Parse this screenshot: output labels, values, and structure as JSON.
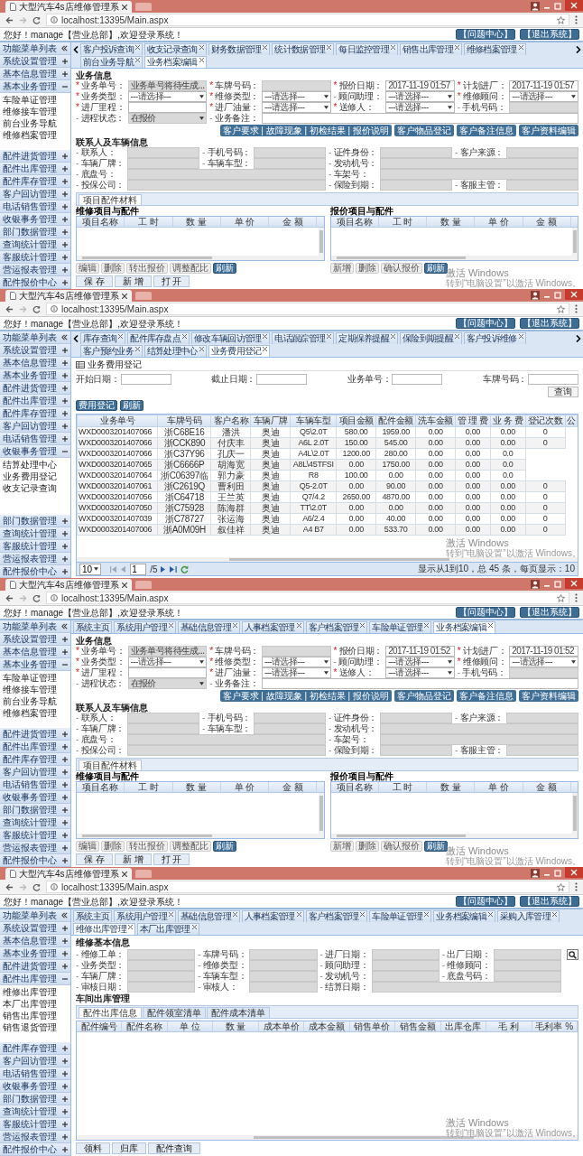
{
  "screens": [
    {
      "browser": {
        "tab_title": "大型汽车4s店维修管理系",
        "url": "localhost:13395/Main.aspx"
      },
      "greeting": "您好！manage【营业总部】,欢迎登录系统！",
      "header_buttons": [
        "【问题中心】",
        "【退出系统】"
      ],
      "sidebar": {
        "title": "功能菜单列表",
        "groups": [
          {
            "label": "系统设置管理",
            "expanded": false
          },
          {
            "label": "基本信息管理",
            "expanded": false
          },
          {
            "label": "基本业务管理",
            "expanded": true,
            "children": [
              "车险单证管理",
              "维修接车管理",
              "前台业务导航",
              "维修档案管理"
            ]
          },
          {
            "label": "配件进货管理",
            "expanded": false
          },
          {
            "label": "配件出库管理",
            "expanded": false
          },
          {
            "label": "配件库存管理",
            "expanded": false
          },
          {
            "label": "客户回访管理",
            "expanded": false
          },
          {
            "label": "电话销售管理",
            "expanded": false
          },
          {
            "label": "收银事务管理",
            "expanded": false
          },
          {
            "label": "部门数据管理",
            "expanded": false
          },
          {
            "label": "查询统计管理",
            "expanded": false
          },
          {
            "label": "客服统计管理",
            "expanded": false
          },
          {
            "label": "营运报表管理",
            "expanded": false
          },
          {
            "label": "配件报价中心",
            "expanded": false
          }
        ]
      },
      "scroll_arrows": true,
      "tabs": [
        {
          "label": "客户投诉查询",
          "selected": false,
          "closable": true
        },
        {
          "label": "收支记录查询",
          "selected": false,
          "closable": true
        },
        {
          "label": "财务数据管理",
          "selected": false,
          "closable": true
        },
        {
          "label": "统计数据管理",
          "selected": false,
          "closable": true
        },
        {
          "label": "每日监控管理",
          "selected": false,
          "closable": true
        },
        {
          "label": "销售出库管理",
          "selected": false,
          "closable": true
        },
        {
          "label": "维修档案管理",
          "selected": false,
          "closable": true
        },
        {
          "label": "前台业务导航",
          "selected": false,
          "closable": true
        },
        {
          "label": "业务档案编辑",
          "selected": true,
          "closable": true
        }
      ],
      "content": {
        "kind": "business_form",
        "sections": [
          {
            "title": "业务信息",
            "rows": [
              [
                {
                  "mark": "*",
                  "required": true,
                  "label": "业务单号：",
                  "kind": "text",
                  "value": "业务单号将待生成...",
                  "disabled": true
                },
                {
                  "mark": "*",
                  "required": true,
                  "label": "车牌号码：",
                  "kind": "text",
                  "disabled": true
                },
                {
                  "mark": "*",
                  "required": true,
                  "label": "报价日期：",
                  "kind": "text",
                  "value": "2017-11-19 01:57",
                  "disabled": false
                },
                {
                  "mark": "*",
                  "required": true,
                  "label": "计划进厂：",
                  "kind": "text",
                  "value": "2017-11-19 01:57",
                  "disabled": false
                }
              ],
              [
                {
                  "mark": "*",
                  "required": true,
                  "label": "业务类型：",
                  "kind": "select",
                  "value": "---请选择---",
                  "disabled": false
                },
                {
                  "mark": "*",
                  "required": true,
                  "label": "维修类型：",
                  "kind": "select",
                  "value": "---请选择---",
                  "disabled": false
                },
                {
                  "mark": "-",
                  "required": false,
                  "label": "顾问助理：",
                  "kind": "select",
                  "value": "---请选择---",
                  "disabled": false
                },
                {
                  "mark": "*",
                  "required": true,
                  "label": "维修顾问：",
                  "kind": "select",
                  "value": "---请选择---",
                  "disabled": false
                }
              ],
              [
                {
                  "mark": "*",
                  "required": true,
                  "label": "进厂里程：",
                  "kind": "text",
                  "disabled": false
                },
                {
                  "mark": "*",
                  "required": true,
                  "label": "进厂油量：",
                  "kind": "select",
                  "value": "---请选择---",
                  "disabled": false
                },
                {
                  "mark": "*",
                  "required": true,
                  "label": "送修人：",
                  "kind": "select",
                  "value": "---请选择---",
                  "disabled": false
                },
                {
                  "mark": "-",
                  "required": false,
                  "label": "手机号码：",
                  "kind": "text",
                  "disabled": true
                }
              ],
              [
                {
                  "mark": "-",
                  "required": false,
                  "label": "进程状态：",
                  "kind": "select",
                  "value": "在报价",
                  "disabled": true
                },
                {
                  "mark": "-",
                  "required": false,
                  "label": "业务备注：",
                  "kind": "text",
                  "disabled": false
                },
                "",
                ""
              ]
            ],
            "actions": [
              "客户要求 | 故障现象 | 初检结果 | 报价说明",
              "客户物品登记",
              "客户备注信息",
              "客户资料编辑"
            ]
          },
          {
            "title": "联系人及车辆信息",
            "rows": [
              [
                {
                  "mark": "-",
                  "required": false,
                  "label": "联系人：",
                  "kind": "text",
                  "disabled": true
                },
                {
                  "mark": "-",
                  "required": false,
                  "label": "手机号码：",
                  "kind": "text",
                  "disabled": true
                },
                {
                  "mark": "-",
                  "required": false,
                  "label": "证件身份：",
                  "kind": "text",
                  "disabled": true
                },
                {
                  "mark": "-",
                  "required": false,
                  "label": "客户来源：",
                  "kind": "text",
                  "disabled": true
                }
              ],
              [
                {
                  "mark": "-",
                  "required": false,
                  "label": "车辆厂牌：",
                  "kind": "text",
                  "disabled": true
                },
                {
                  "mark": "-",
                  "required": false,
                  "label": "车辆车型：",
                  "kind": "text",
                  "disabled": true
                },
                {
                  "mark": "-",
                  "required": false,
                  "label": "发动机号：",
                  "kind": "text",
                  "disabled": true
                },
                ""
              ],
              [
                {
                  "mark": "-",
                  "required": false,
                  "label": "底盘号：",
                  "kind": "text",
                  "disabled": true
                },
                "",
                {
                  "mark": "-",
                  "required": false,
                  "label": "车架号：",
                  "kind": "text",
                  "disabled": true
                },
                ""
              ],
              [
                {
                  "mark": "-",
                  "required": false,
                  "label": "投保公司：",
                  "kind": "text",
                  "disabled": true
                },
                "",
                {
                  "mark": "-",
                  "required": false,
                  "label": "保险到期：",
                  "kind": "text",
                  "disabled": true
                },
                {
                  "mark": "-",
                  "required": false,
                  "label": "客服主管：",
                  "kind": "text",
                  "disabled": true
                }
              ]
            ]
          }
        ],
        "subtab": "项目配件材料",
        "grids": [
          {
            "title": "维修项目与配件",
            "columns": [
              "项目名称",
              "工 时",
              "数 量",
              "单 价",
              "金 额"
            ],
            "buttons": [
              {
                "label": "编辑",
                "kind": "plain"
              },
              {
                "label": "删除",
                "kind": "plain"
              },
              {
                "label": "转出报价",
                "kind": "plain"
              },
              {
                "label": "调整配比",
                "kind": "plain"
              },
              {
                "label": "刷新",
                "kind": "primary"
              }
            ]
          },
          {
            "title": "报价项目与配件",
            "columns": [
              "项目名称",
              "工 时",
              "数 量",
              "单 价",
              "金 额"
            ],
            "buttons": [
              {
                "label": "新增",
                "kind": "plain"
              },
              {
                "label": "删除",
                "kind": "plain"
              },
              {
                "label": "确认报价",
                "kind": "plain"
              },
              {
                "label": "刷新",
                "kind": "primary"
              }
            ]
          }
        ],
        "footer_buttons": [
          "保 存",
          "新 增",
          "打 开"
        ]
      },
      "os_notice": {
        "title": "激活 Windows",
        "text": "转到“电脑设置”以激活 Windows。"
      }
    },
    {
      "browser": {
        "tab_title": "大型汽车4s店维修管理系",
        "url": "localhost:13395/Main.aspx"
      },
      "greeting": "您好！manage【营业总部】,欢迎登录系统！",
      "header_buttons": [
        "【问题中心】",
        "【退出系统】"
      ],
      "sidebar": {
        "title": "功能菜单列表",
        "groups": [
          {
            "label": "系统设置管理",
            "expanded": false
          },
          {
            "label": "基本信息管理",
            "expanded": false
          },
          {
            "label": "基本业务管理",
            "expanded": false
          },
          {
            "label": "配件进货管理",
            "expanded": false
          },
          {
            "label": "配件出库管理",
            "expanded": false
          },
          {
            "label": "配件库存管理",
            "expanded": false
          },
          {
            "label": "客户回访管理",
            "expanded": false
          },
          {
            "label": "电话销售管理",
            "expanded": false
          },
          {
            "label": "收银事务管理",
            "expanded": true,
            "children": [
              "结算处理中心",
              "业务费用登记",
              "收支记录查询"
            ]
          },
          {
            "label": "部门数据管理",
            "expanded": false
          },
          {
            "label": "查询统计管理",
            "expanded": false
          },
          {
            "label": "客服统计管理",
            "expanded": false
          },
          {
            "label": "营运报表管理",
            "expanded": false
          },
          {
            "label": "配件报价中心",
            "expanded": false
          }
        ]
      },
      "scroll_arrows": true,
      "tabs": [
        {
          "label": "库存查询",
          "selected": false,
          "closable": true
        },
        {
          "label": "配件库存盘点",
          "selected": false,
          "closable": true
        },
        {
          "label": "修改车辆回访管理",
          "selected": false,
          "closable": true
        },
        {
          "label": "电话跟踪管理",
          "selected": false,
          "closable": true
        },
        {
          "label": "定期保养提醒",
          "selected": false,
          "closable": true
        },
        {
          "label": "保险到期提醒",
          "selected": false,
          "closable": true
        },
        {
          "label": "客户投诉维修",
          "selected": false,
          "closable": true
        },
        {
          "label": "客户预约业务",
          "selected": false,
          "closable": true
        },
        {
          "label": "结算处理中心",
          "selected": false,
          "closable": true
        },
        {
          "label": "业务费用登记",
          "selected": true,
          "closable": true
        }
      ],
      "content": {
        "kind": "fee_list",
        "title": "业务费用登记",
        "filters": [
          "开始日期：",
          "截止日期：",
          "业务单号：",
          "车牌号码："
        ],
        "search_button": "查询",
        "buttons": [
          {
            "label": "费用登记",
            "kind": "primary"
          },
          {
            "label": "刷新",
            "kind": "primary"
          }
        ],
        "columns": [
          "业务单号",
          "车牌号码",
          "客户名称",
          "车辆厂牌",
          "车辆车型",
          "项目金额",
          "配件金额",
          "洗车金额",
          "管 理 费",
          "业 务 费",
          "登记次数",
          "公"
        ],
        "rows": [
          [
            "WXD0003201407066",
            "浙C68E16",
            "潘洪",
            "奥迪",
            "Q5\\2.0T",
            "580.00",
            "1959.00",
            "0.00",
            "0.00",
            "0.00",
            "0"
          ],
          [
            "WXD0003201407066",
            "浙CCK890",
            "付庆丰",
            "奥迪",
            "A6L 2.0T",
            "150.00",
            "545.00",
            "0.00",
            "0.00",
            "0.00",
            "0"
          ],
          [
            "WXD0003201407066",
            "浙C37Y96",
            "孔庆一",
            "奥迪",
            "A4L\\2.0T",
            "1200.00",
            "280.00",
            "0.00",
            "0.00",
            "0.0"
          ],
          [
            "WXD0003201407065",
            "浙C6666P",
            "胡海宽",
            "奥迪",
            "A8L\\45TFSI",
            "0.00",
            "1750.00",
            "0.00",
            "0.00",
            "0.0"
          ],
          [
            "WXD0003201407064",
            "浙C06397临",
            "郭力豪",
            "奥迪",
            "R8",
            "100.00",
            "0.00",
            "0.00",
            "0.00",
            "0.0"
          ],
          [
            "WXD0003201407061",
            "浙C2619Q",
            "曹利田",
            "奥迪",
            "Q5-2.0T",
            "0.00",
            "90.00",
            "0.00",
            "0.00",
            "0.00",
            "0"
          ],
          [
            "WXD0003201407056",
            "浙C64718",
            "王兰英",
            "奥迪",
            "Q7/4.2",
            "2650.00",
            "4870.00",
            "0.00",
            "0.00",
            "0.00",
            "0"
          ],
          [
            "WXD0003201407050",
            "浙C75928",
            "陈海群",
            "奥迪",
            "TT\\2.0T",
            "0.00",
            "0.00",
            "0.00",
            "0.00",
            "0.00",
            "0"
          ],
          [
            "WXD0003201407039",
            "浙C78727",
            "张运海",
            "奥迪",
            "A6/2.4",
            "0.00",
            "40.00",
            "0.00",
            "0.00",
            "0.00",
            "0"
          ],
          [
            "WXD0003201407006",
            "浙A0M09H",
            "叙佳祥",
            "奥迪",
            "A4 B7",
            "0.00",
            "533.70",
            "0.00",
            "0.00",
            "0.00",
            "0"
          ]
        ],
        "pager": {
          "page_size": "10",
          "page": "1",
          "pages": "/5",
          "summary": "显示从1到10，总 45 条，每页显示：10"
        }
      },
      "os_notice": {
        "title": "激活 Windows",
        "text": "转到“电脑设置”以激活 Windows。"
      }
    },
    {
      "browser": {
        "tab_title": "大型汽车4s店维修管理系",
        "url": "localhost:13395/Main.aspx"
      },
      "greeting": "您好！manage【营业总部】,欢迎登录系统！",
      "header_buttons": [
        "【问题中心】",
        "【退出系统】"
      ],
      "sidebar": {
        "title": "功能菜单列表",
        "groups": [
          {
            "label": "系统设置管理",
            "expanded": false
          },
          {
            "label": "基本信息管理",
            "expanded": false
          },
          {
            "label": "基本业务管理",
            "expanded": true,
            "children": [
              "车险单证管理",
              "维修接车管理",
              "前台业务导航",
              "维修档案管理"
            ]
          },
          {
            "label": "配件进货管理",
            "expanded": false
          },
          {
            "label": "配件出库管理",
            "expanded": false
          },
          {
            "label": "配件库存管理",
            "expanded": false
          },
          {
            "label": "客户回访管理",
            "expanded": false
          },
          {
            "label": "电话销售管理",
            "expanded": false
          },
          {
            "label": "收银事务管理",
            "expanded": false
          },
          {
            "label": "部门数据管理",
            "expanded": false
          },
          {
            "label": "查询统计管理",
            "expanded": false
          },
          {
            "label": "客服统计管理",
            "expanded": false
          },
          {
            "label": "营运报表管理",
            "expanded": false
          },
          {
            "label": "配件报价中心",
            "expanded": false
          }
        ]
      },
      "scroll_arrows": false,
      "tabs": [
        {
          "label": "系统主页",
          "selected": false,
          "closable": false
        },
        {
          "label": "系统用户管理",
          "selected": false,
          "closable": true
        },
        {
          "label": "基础信息管理",
          "selected": false,
          "closable": true
        },
        {
          "label": "人事档案管理",
          "selected": false,
          "closable": true
        },
        {
          "label": "客户档案管理",
          "selected": false,
          "closable": true
        },
        {
          "label": "车险单证管理",
          "selected": false,
          "closable": true
        },
        {
          "label": "业务档案编辑",
          "selected": true,
          "closable": true
        }
      ],
      "content": {
        "kind": "business_form",
        "sections": [
          {
            "title": "业务信息",
            "rows": [
              [
                {
                  "mark": "*",
                  "required": true,
                  "label": "业务单号：",
                  "kind": "text",
                  "value": "业务单号将待生成...",
                  "disabled": true
                },
                {
                  "mark": "*",
                  "required": true,
                  "label": "车牌号码：",
                  "kind": "text",
                  "disabled": true
                },
                {
                  "mark": "*",
                  "required": true,
                  "label": "报价日期：",
                  "kind": "text",
                  "value": "2017-11-19 01:52",
                  "disabled": false
                },
                {
                  "mark": "*",
                  "required": true,
                  "label": "计划进厂：",
                  "kind": "text",
                  "value": "2017-11-19 01:52",
                  "disabled": false
                }
              ],
              [
                {
                  "mark": "*",
                  "required": true,
                  "label": "业务类型：",
                  "kind": "select",
                  "value": "---请选择---",
                  "disabled": false
                },
                {
                  "mark": "*",
                  "required": true,
                  "label": "维修类型：",
                  "kind": "select",
                  "value": "---请选择---",
                  "disabled": false
                },
                {
                  "mark": "-",
                  "required": false,
                  "label": "顾问助理：",
                  "kind": "select",
                  "value": "---请选择---",
                  "disabled": false
                },
                {
                  "mark": "*",
                  "required": true,
                  "label": "维修顾问：",
                  "kind": "select",
                  "value": "---请选择---",
                  "disabled": false
                }
              ],
              [
                {
                  "mark": "*",
                  "required": true,
                  "label": "进厂里程：",
                  "kind": "text",
                  "disabled": false
                },
                {
                  "mark": "*",
                  "required": true,
                  "label": "进厂油量：",
                  "kind": "select",
                  "value": "---请选择---",
                  "disabled": false
                },
                {
                  "mark": "*",
                  "required": true,
                  "label": "送修人：",
                  "kind": "select",
                  "value": "---请选择---",
                  "disabled": false
                },
                {
                  "mark": "-",
                  "required": false,
                  "label": "手机号码：",
                  "kind": "text",
                  "disabled": true
                }
              ],
              [
                {
                  "mark": "-",
                  "required": false,
                  "label": "进程状态：",
                  "kind": "select",
                  "value": "在报价",
                  "disabled": true
                },
                {
                  "mark": "-",
                  "required": false,
                  "label": "业务备注：",
                  "kind": "text",
                  "disabled": false
                },
                "",
                ""
              ]
            ],
            "actions": [
              "客户要求 | 故障现象 | 初检结果 | 报价说明",
              "客户物品登记",
              "客户备注信息",
              "客户资料编辑"
            ]
          },
          {
            "title": "联系人及车辆信息",
            "rows": [
              [
                {
                  "mark": "-",
                  "required": false,
                  "label": "联系人：",
                  "kind": "text",
                  "disabled": true
                },
                {
                  "mark": "-",
                  "required": false,
                  "label": "手机号码：",
                  "kind": "text",
                  "disabled": true
                },
                {
                  "mark": "-",
                  "required": false,
                  "label": "证件身份：",
                  "kind": "text",
                  "disabled": true
                },
                {
                  "mark": "-",
                  "required": false,
                  "label": "客户来源：",
                  "kind": "text",
                  "disabled": true
                }
              ],
              [
                {
                  "mark": "-",
                  "required": false,
                  "label": "车辆厂牌：",
                  "kind": "text",
                  "disabled": true
                },
                {
                  "mark": "-",
                  "required": false,
                  "label": "车辆车型：",
                  "kind": "text",
                  "disabled": true
                },
                {
                  "mark": "-",
                  "required": false,
                  "label": "发动机号：",
                  "kind": "text",
                  "disabled": true
                },
                ""
              ],
              [
                {
                  "mark": "-",
                  "required": false,
                  "label": "底盘号：",
                  "kind": "text",
                  "disabled": true
                },
                "",
                {
                  "mark": "-",
                  "required": false,
                  "label": "车架号：",
                  "kind": "text",
                  "disabled": true
                },
                ""
              ],
              [
                {
                  "mark": "-",
                  "required": false,
                  "label": "投保公司：",
                  "kind": "text",
                  "disabled": true
                },
                "",
                {
                  "mark": "-",
                  "required": false,
                  "label": "保险到期：",
                  "kind": "text",
                  "disabled": true
                },
                {
                  "mark": "-",
                  "required": false,
                  "label": "客服主管：",
                  "kind": "text",
                  "disabled": true
                }
              ]
            ]
          }
        ],
        "subtab": "项目配件材料",
        "grids": [
          {
            "title": "维修项目与配件",
            "columns": [
              "项目名称",
              "工 时",
              "数 量",
              "单 价",
              "金 额"
            ],
            "buttons": [
              {
                "label": "编辑",
                "kind": "plain"
              },
              {
                "label": "删除",
                "kind": "plain"
              },
              {
                "label": "转出报价",
                "kind": "plain"
              },
              {
                "label": "调整配比",
                "kind": "plain"
              },
              {
                "label": "刷新",
                "kind": "primary"
              }
            ]
          },
          {
            "title": "报价项目与配件",
            "columns": [
              "项目名称",
              "工 时",
              "数 量",
              "单 价",
              "金 额"
            ],
            "buttons": [
              {
                "label": "新增",
                "kind": "plain"
              },
              {
                "label": "删除",
                "kind": "plain"
              },
              {
                "label": "确认报价",
                "kind": "plain"
              },
              {
                "label": "刷新",
                "kind": "primary"
              }
            ]
          }
        ],
        "footer_buttons": [
          "保 存",
          "新 增",
          "打 开"
        ]
      },
      "os_notice": {
        "title": "激活 Windows",
        "text": "转到“电脑设置”以激活 Windows。"
      }
    },
    {
      "browser": {
        "tab_title": "大型汽车4s店维修管理系",
        "url": "localhost:13395/Main.aspx"
      },
      "greeting": "您好！manage【营业总部】,欢迎登录系统！",
      "header_buttons": [
        "【问题中心】",
        "【退出系统】"
      ],
      "sidebar": {
        "title": "功能菜单列表",
        "groups": [
          {
            "label": "系统设置管理",
            "expanded": false
          },
          {
            "label": "基本信息管理",
            "expanded": false
          },
          {
            "label": "基本业务管理",
            "expanded": false
          },
          {
            "label": "配件进货管理",
            "expanded": false
          },
          {
            "label": "配件出库管理",
            "expanded": true,
            "children": [
              "维修出库管理",
              "本厂出库管理",
              "销售出库管理",
              "销售退货管理"
            ]
          },
          {
            "label": "配件库存管理",
            "expanded": false
          },
          {
            "label": "客户回访管理",
            "expanded": false
          },
          {
            "label": "电话销售管理",
            "expanded": false
          },
          {
            "label": "收银事务管理",
            "expanded": false
          },
          {
            "label": "部门数据管理",
            "expanded": false
          },
          {
            "label": "查询统计管理",
            "expanded": false
          },
          {
            "label": "客服统计管理",
            "expanded": false
          },
          {
            "label": "营运报表管理",
            "expanded": false
          },
          {
            "label": "配件报价中心",
            "expanded": false
          }
        ]
      },
      "scroll_arrows": false,
      "tabs": [
        {
          "label": "系统主页",
          "selected": false,
          "closable": false
        },
        {
          "label": "系统用户管理",
          "selected": false,
          "closable": true
        },
        {
          "label": "基础信息管理",
          "selected": false,
          "closable": true
        },
        {
          "label": "人事档案管理",
          "selected": false,
          "closable": true
        },
        {
          "label": "客户档案管理",
          "selected": false,
          "closable": true
        },
        {
          "label": "车险单证管理",
          "selected": false,
          "closable": true
        },
        {
          "label": "业务档案编辑",
          "selected": false,
          "closable": true
        },
        {
          "label": "采购入库管理",
          "selected": false,
          "closable": true
        },
        {
          "label": "维修出库管理",
          "selected": true,
          "closable": true
        },
        {
          "label": "本厂出库管理",
          "selected": false,
          "closable": true
        }
      ],
      "content": {
        "kind": "stock_out",
        "title": "维修基本信息",
        "field_rows": [
          [
            {
              "mark": "-",
              "required": false,
              "label": "维修工单：",
              "kind": "text",
              "disabled": true
            },
            {
              "mark": "-",
              "required": false,
              "label": "车牌号码：",
              "kind": "text",
              "disabled": true
            },
            {
              "mark": "-",
              "required": false,
              "label": "进厂日期：",
              "kind": "text",
              "disabled": true
            },
            {
              "mark": "-",
              "required": false,
              "label": "出厂日期：",
              "kind": "text",
              "disabled": true
            }
          ],
          [
            {
              "mark": "-",
              "required": false,
              "label": "业务类型：",
              "kind": "text",
              "disabled": true
            },
            {
              "mark": "-",
              "required": false,
              "label": "维修类型：",
              "kind": "text",
              "disabled": true
            },
            {
              "mark": "-",
              "required": false,
              "label": "顾问助理：",
              "kind": "text",
              "disabled": true
            },
            {
              "mark": "-",
              "required": false,
              "label": "维修顾问：",
              "kind": "text",
              "disabled": true
            }
          ],
          [
            {
              "mark": "-",
              "required": false,
              "label": "车辆厂牌：",
              "kind": "text",
              "disabled": true
            },
            {
              "mark": "-",
              "required": false,
              "label": "车辆车型：",
              "kind": "text",
              "disabled": true
            },
            {
              "mark": "-",
              "required": false,
              "label": "发动机号：",
              "kind": "text",
              "disabled": true
            },
            {
              "mark": "-",
              "required": false,
              "label": "底盘号码：",
              "kind": "text",
              "disabled": true
            }
          ],
          [
            {
              "mark": "-",
              "required": false,
              "label": "审核日期：",
              "kind": "text",
              "disabled": true
            },
            {
              "mark": "-",
              "required": false,
              "label": "审核人：",
              "kind": "text",
              "disabled": true
            },
            {
              "mark": "-",
              "required": false,
              "label": "结算日期：",
              "kind": "text",
              "disabled": true
            },
            ""
          ]
        ],
        "search_button": true,
        "section": "车间出库管理",
        "subtabs": [
          {
            "label": "配件出库信息",
            "selected": true
          },
          {
            "label": "配件领室清单",
            "selected": false
          },
          {
            "label": "配件成本清单",
            "selected": false
          }
        ],
        "columns": [
          "配件编号",
          "配件名称",
          "单 位",
          "数 量",
          "成本单价",
          "成本金额",
          "销售单价",
          "销售金额",
          "出库仓库",
          "毛 利",
          "毛利率 %"
        ],
        "buttons": [
          "领料",
          "归库",
          "配件查询"
        ]
      },
      "os_notice": {
        "title": "激活 Windows",
        "text": "转到“电脑设置”以激活 Windows。"
      }
    }
  ]
}
